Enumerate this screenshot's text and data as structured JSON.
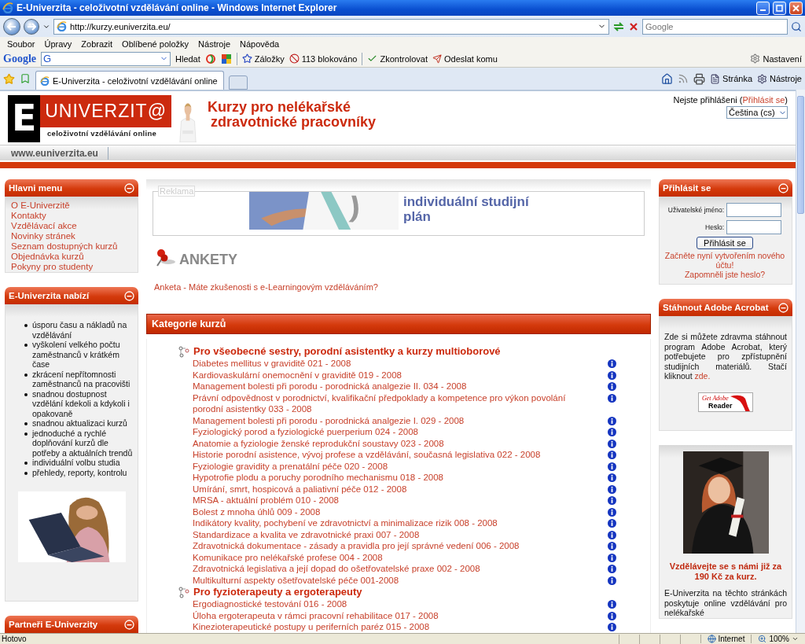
{
  "browser": {
    "title": "E-Univerzita - celoživotní vzdělávání online - Windows Internet Explorer",
    "address": "http://kurzy.euniverzita.eu/",
    "search_placeholder": "Google",
    "menu": [
      "Soubor",
      "Úpravy",
      "Zobrazit",
      "Oblíbené položky",
      "Nástroje",
      "Nápověda"
    ],
    "google_toolbar": {
      "logo": "Google",
      "engine": "G",
      "search_button": "Hledat",
      "bookmarks": "Záložky",
      "blocked": "113 blokováno",
      "spellcheck": "Zkontrolovat",
      "send": "Odeslat komu",
      "settings": "Nastavení"
    },
    "tabs": [
      {
        "label": "E-Univerzita - celoživotní vzdělávání online",
        "selected": true
      }
    ],
    "commands": [
      "Stránka",
      "Nástroje"
    ]
  },
  "header": {
    "logo_letter": "E",
    "logo_name": "UNIVERZIT@",
    "logo_tagline": "celoživotní vzdělávání online",
    "title_lines": [
      "Kurzy pro nelékařské",
      "zdravotnické pracovníky"
    ],
    "login_status": "Nejste přihlášeni (",
    "login_link": "Přihlásit se",
    "login_status_end": ")",
    "language": "Čeština (cs)",
    "site_url": "www.euniverzita.eu"
  },
  "left": {
    "main_menu": {
      "title": "Hlavni menu",
      "items": [
        "O E-Univerzitě",
        "Kontakty",
        "Vzdělávací akce",
        "Novinky stránek",
        "Seznam dostupných kurzů",
        "Objednávka kurzů",
        "Pokyny pro studenty"
      ]
    },
    "offers": {
      "title": "E-Univerzita nabízí",
      "items": [
        "úsporu času a nákladů na vzdělávání",
        "vyškolení velkého počtu zaměstnanců v krátkém čase",
        "zkrácení nepřítomnosti zaměstnanců na pracovišti",
        "snadnou dostupnost vzdělání kdekoli a kdykoli i opakovaně",
        "snadnou aktualizaci kurzů",
        "jednoduché a rychlé doplňování kurzů dle potřeby a aktuálních trendů",
        "individuální volbu studia",
        "přehledy, reporty, kontrolu"
      ]
    },
    "partners": {
      "title": "Partneři E-Univerzity"
    }
  },
  "center": {
    "ad": {
      "label": "Reklama",
      "text": "individuální studijní plán"
    },
    "polls": {
      "title": "ANKETY",
      "link": "Anketa - Máte zkušenosti s e-Learningovým vzděláváním?"
    },
    "categories": {
      "title": "Kategorie kurzů",
      "groups": [
        {
          "name": "Pro všeobecné sestry, porodní asistentky a kurzy multioborové",
          "courses": [
            "Diabetes mellitus v graviditě 021 - 2008",
            "Kardiovaskulární onemocnění v graviditě 019 - 2008",
            "Management bolesti při porodu - porodnická analgezie II. 034 - 2008",
            "Právní odpovědnost v porodnictví, kvalifikační předpoklady a kompetence pro výkon povolání porodní asistentky 033 - 2008",
            "Management bolesti při porodu - porodnická analgezie I. 029 - 2008",
            "Fyziologický porod a fyziologické puerperium 024 - 2008",
            "Anatomie a fyziologie ženské reprodukční soustavy 023 - 2008",
            "Historie porodní asistence, vývoj profese a vzdělávání, současná legislativa 022 - 2008",
            "Fyziologie gravidity a prenatální péče 020 - 2008",
            "Hypotrofie plodu a poruchy porodního mechanismu 018 - 2008",
            "Umírání, smrt, hospicová a paliativní péče 012 - 2008",
            "MRSA - aktuální problém 010 - 2008",
            "Bolest z mnoha úhlů 009 - 2008",
            "Indikátory kvality, pochybení ve zdravotnictví a minimalizace rizik 008 - 2008",
            "Standardizace a kvalita ve zdravotnické praxi 007 - 2008",
            "Zdravotnická dokumentace - zásady a pravidla pro její správné vedení 006 - 2008",
            "Komunikace pro nelékařské profese 004 - 2008",
            "Zdravotnická legislativa a její dopad do ošetřovatelské praxe 002 - 2008",
            "Multikulturní aspekty ošetřovatelské péče 001-2008"
          ]
        },
        {
          "name": "Pro fyzioterapeuty a ergoterapeuty",
          "courses": [
            "Ergodiagnostické testování 016 - 2008",
            "Úloha ergoterapeuta v rámci pracovní rehabilitace 017 - 2008",
            "Kinezioterapeutické postupy u periferních paréz 015 - 2008"
          ]
        }
      ]
    }
  },
  "right": {
    "login": {
      "title": "Přihlásit se",
      "username_label": "Uživatelské jméno:",
      "password_label": "Heslo:",
      "button": "Přihlásit se",
      "links": [
        "Začněte nyní vytvořením nového účtu!",
        "Zapomněli jste heslo?"
      ]
    },
    "acrobat": {
      "title": "Stáhnout Adobe Acrobat",
      "text": "Zde si můžete zdravma stáhnout program Adobe Acrobat, který potřebujete pro zpřístupnění studijních materiálů. Stačí kliknout",
      "link": "zde.",
      "badge_top": "Get Adobe",
      "badge_bottom": "Reader"
    },
    "promo": {
      "headline": "Vzdělávejte se s námi již za 190 Kč za kurz.",
      "text": "E-Univerzita na těchto stránkách poskytuje online vzdělávání pro nelékařské"
    }
  },
  "status_bar": {
    "text": "Hotovo",
    "zone": "Internet",
    "zoom": "100%"
  }
}
